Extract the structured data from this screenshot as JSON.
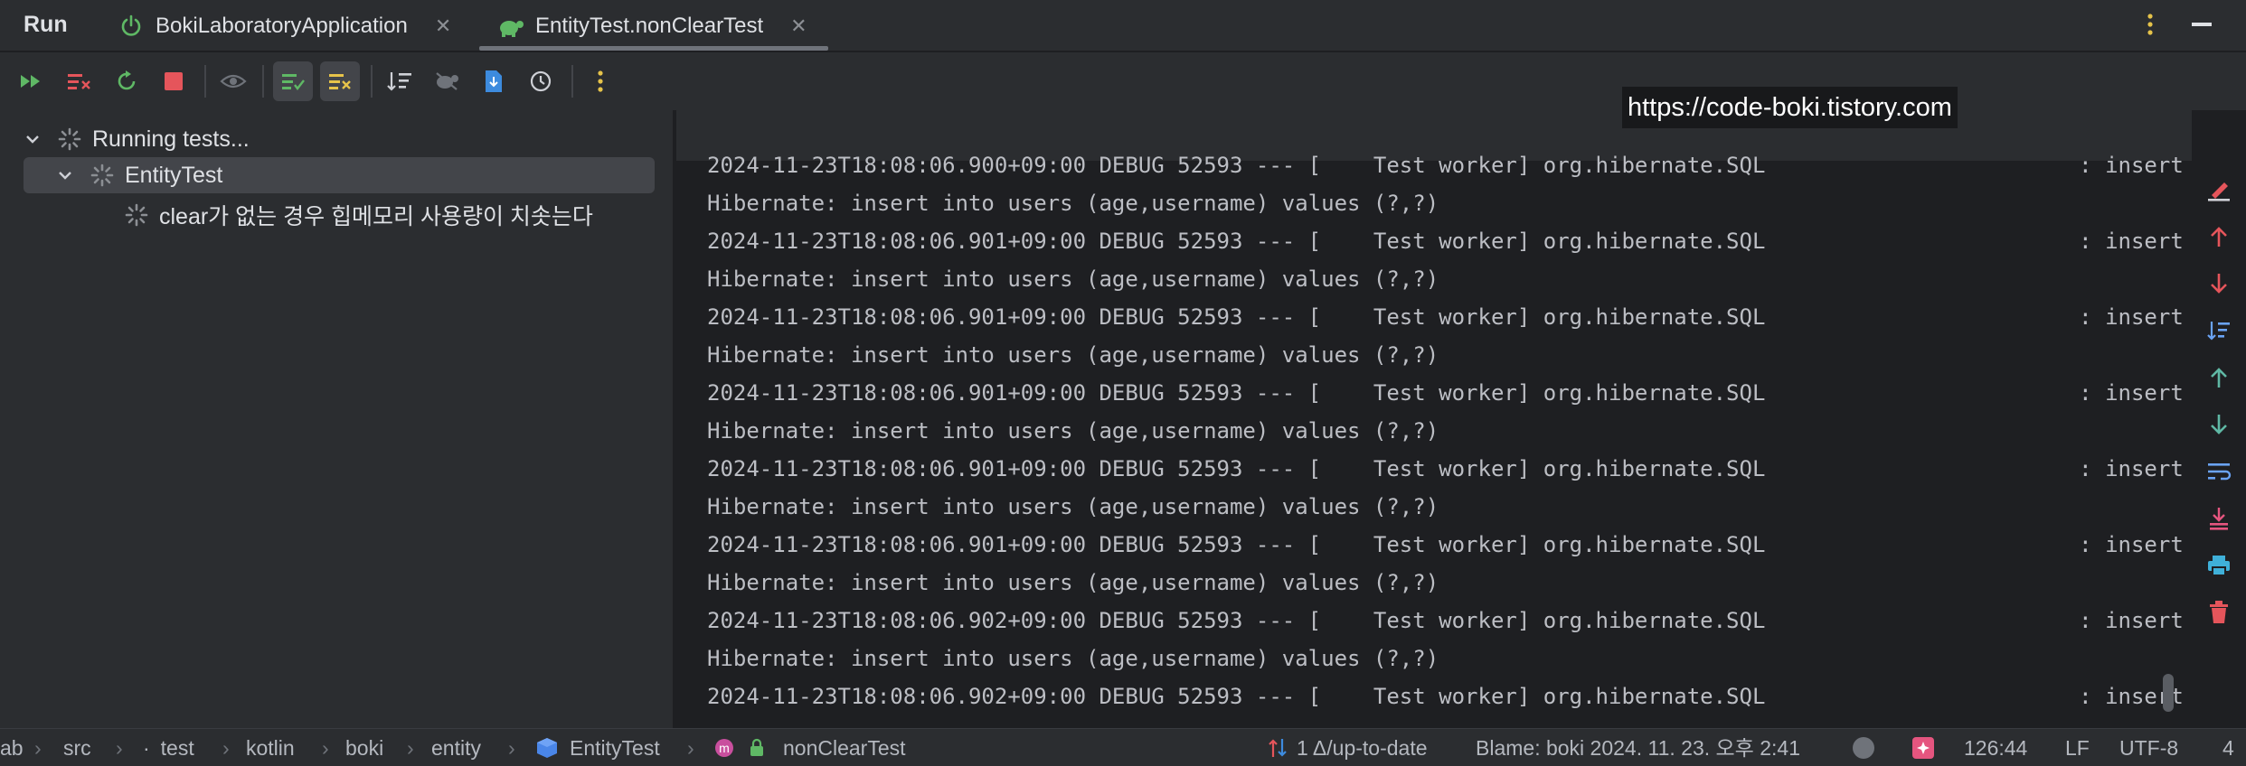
{
  "tabs": {
    "run_title": "Run",
    "items": [
      {
        "label": "BokiLaboratoryApplication",
        "icon": "power-icon"
      },
      {
        "label": "EntityTest.nonClearTest",
        "icon": "turtle-icon"
      }
    ]
  },
  "toolbar": {
    "buttons": [
      "rerun-failed-icon",
      "stop-rerun-icon",
      "rerun-icon",
      "stop-icon",
      "eye-icon",
      "show-passed-icon",
      "show-ignored-icon",
      "sort-icon",
      "import-tests-icon",
      "export-icon",
      "history-icon",
      "more-icon"
    ]
  },
  "tree": {
    "root": "Running tests...",
    "class": "EntityTest",
    "test": "clear가 없는 경우 힙메모리 사용량이 치솟는다"
  },
  "console": {
    "watermark": "https://code-boki.tistory.com",
    "lines": [
      "2024-11-23T18:08:06.900+09:00 DEBUG 52593 --- [    Test worker] org.hibernate.SQL                        : insert",
      "Hibernate: insert into users (age,username) values (?,?)",
      "2024-11-23T18:08:06.901+09:00 DEBUG 52593 --- [    Test worker] org.hibernate.SQL                        : insert",
      "Hibernate: insert into users (age,username) values (?,?)",
      "2024-11-23T18:08:06.901+09:00 DEBUG 52593 --- [    Test worker] org.hibernate.SQL                        : insert",
      "Hibernate: insert into users (age,username) values (?,?)",
      "2024-11-23T18:08:06.901+09:00 DEBUG 52593 --- [    Test worker] org.hibernate.SQL                        : insert",
      "Hibernate: insert into users (age,username) values (?,?)",
      "2024-11-23T18:08:06.901+09:00 DEBUG 52593 --- [    Test worker] org.hibernate.SQL                        : insert",
      "Hibernate: insert into users (age,username) values (?,?)",
      "2024-11-23T18:08:06.901+09:00 DEBUG 52593 --- [    Test worker] org.hibernate.SQL                        : insert",
      "Hibernate: insert into users (age,username) values (?,?)",
      "2024-11-23T18:08:06.902+09:00 DEBUG 52593 --- [    Test worker] org.hibernate.SQL                        : insert",
      "Hibernate: insert into users (age,username) values (?,?)",
      "2024-11-23T18:08:06.902+09:00 DEBUG 52593 --- [    Test worker] org.hibernate.SQL                        : insert"
    ]
  },
  "side_tools": [
    "clear-console-icon",
    "arrow-up-icon",
    "arrow-down-icon",
    "sort-down-icon",
    "navigate-up-icon",
    "navigate-down-icon",
    "soft-wrap-icon",
    "scroll-to-end-icon",
    "print-icon",
    "trash-icon"
  ],
  "statusbar": {
    "breadcrumbs": [
      "ab",
      "src",
      "test",
      "kotlin",
      "boki",
      "entity",
      "EntityTest",
      "nonClearTest"
    ],
    "vcs": "1 Δ/up-to-date",
    "blame": "Blame: boki 2024. 11. 23. 오후 2:41",
    "position": "126:44",
    "line_sep": "LF",
    "encoding": "UTF-8",
    "indent": "4"
  },
  "colors": {
    "accent_green": "#5fb865",
    "stop_red": "#e5555b",
    "console_bg": "#1e1f22",
    "panel_bg": "#2b2d30"
  }
}
